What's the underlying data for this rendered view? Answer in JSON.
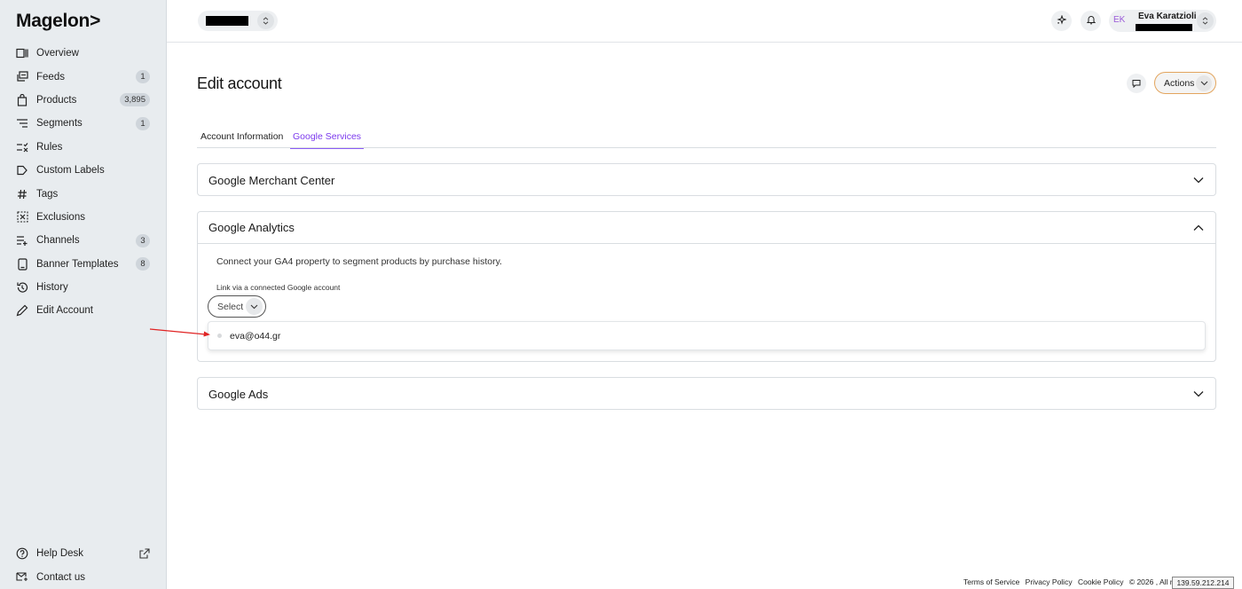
{
  "app": {
    "logo": "Magelon>"
  },
  "sidebar": {
    "items": [
      {
        "label": "Overview",
        "icon": "overview-icon",
        "badge": ""
      },
      {
        "label": "Feeds",
        "icon": "feeds-icon",
        "badge": "1"
      },
      {
        "label": "Products",
        "icon": "bag-icon",
        "badge": "3,895"
      },
      {
        "label": "Segments",
        "icon": "segments-icon",
        "badge": "1"
      },
      {
        "label": "Rules",
        "icon": "rules-icon",
        "badge": ""
      },
      {
        "label": "Custom Labels",
        "icon": "label-icon",
        "badge": ""
      },
      {
        "label": "Tags",
        "icon": "hash-icon",
        "badge": ""
      },
      {
        "label": "Exclusions",
        "icon": "exclusion-icon",
        "badge": ""
      },
      {
        "label": "Channels",
        "icon": "channels-icon",
        "badge": "3"
      },
      {
        "label": "Banner Templates",
        "icon": "banner-icon",
        "badge": "8"
      },
      {
        "label": "History",
        "icon": "history-icon",
        "badge": ""
      },
      {
        "label": "Edit Account",
        "icon": "pencil-icon",
        "badge": ""
      }
    ],
    "bottom": [
      {
        "label": "Help Desk",
        "icon": "help-icon"
      },
      {
        "label": "Contact us",
        "icon": "contact-icon"
      }
    ]
  },
  "topbar": {
    "user_initials": "EK",
    "user_name": "Eva Karatzioli"
  },
  "page": {
    "title": "Edit account",
    "actions_label": "Actions",
    "tabs": [
      {
        "label": "Account Information",
        "active": false
      },
      {
        "label": "Google Services",
        "active": true
      }
    ]
  },
  "panels": {
    "merchant": {
      "title": "Google Merchant Center"
    },
    "analytics": {
      "title": "Google Analytics",
      "description": "Connect your GA4 property to segment products by purchase history.",
      "link_label": "Link via a connected Google account",
      "select_label": "Select",
      "options": [
        "eva@o44.gr"
      ]
    },
    "ads": {
      "title": "Google Ads"
    }
  },
  "footer": {
    "terms": "Terms of Service",
    "privacy": "Privacy Policy",
    "cookie": "Cookie Policy",
    "copyright": "© 2026 , All r",
    "ip": "139.59.212.214"
  },
  "colors": {
    "accent": "#7c3aed",
    "actions_border": "#e3a55e",
    "sidebar_bg": "#e8ecef",
    "annotation_arrow": "#e02424"
  }
}
